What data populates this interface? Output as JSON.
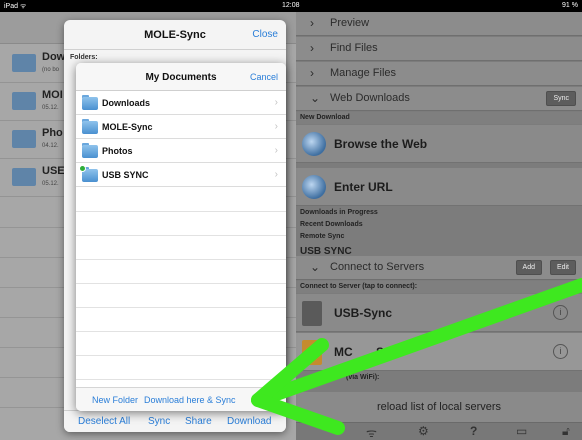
{
  "status_bar": {
    "device": "iPad ᯤ",
    "time": "12:08",
    "battery": "91 %"
  },
  "left_list": {
    "items": [
      {
        "title": "Dow",
        "subtitle": "(no bo"
      },
      {
        "title": "MOI",
        "subtitle": "05.12."
      },
      {
        "title": "Pho",
        "subtitle": "04.12."
      },
      {
        "title": "USE",
        "subtitle": "05.12."
      }
    ]
  },
  "outer_popover": {
    "title": "MOLE-Sync",
    "close_label": "Close",
    "folders_label": "Folders:",
    "toolbar": {
      "deselect_all": "Deselect All",
      "sync": "Sync",
      "share": "Share",
      "download": "Download"
    }
  },
  "inner_popover": {
    "title": "My Documents",
    "cancel_label": "Cancel",
    "folders": [
      {
        "label": "Downloads",
        "chevron": "›"
      },
      {
        "label": "MOLE-Sync",
        "chevron": "›"
      },
      {
        "label": "Photos",
        "chevron": "›"
      },
      {
        "label": "USB SYNC",
        "chevron": "›"
      }
    ],
    "footer": {
      "new_folder": "New Folder",
      "download_here": "Download here & Sync"
    }
  },
  "right_pane": {
    "menu": [
      {
        "chevron": "›",
        "label": "Preview"
      },
      {
        "chevron": "›",
        "label": "Find Files"
      },
      {
        "chevron": "›",
        "label": "Manage Files"
      }
    ],
    "web_downloads": {
      "chevron": "⌄",
      "label": "Web Downloads",
      "sync_button": "Sync",
      "new_download_header": "New Download",
      "browse": "Browse the Web",
      "enter_url": "Enter URL",
      "in_progress": "Downloads in Progress",
      "recent": "Recent Downloads",
      "remote_sync": "Remote Sync",
      "usb_sync_partial": "USB SYNC"
    },
    "servers": {
      "chevron": "⌄",
      "label": "Connect to Servers",
      "add_button": "Add",
      "edit_button": "Edit",
      "connect_header": "Connect to Server (tap to connect):",
      "usb_sync": "USB-Sync",
      "mole_sync_partial": "MC",
      "mole_sync_partial_2": "Sync",
      "wifi_header_partial": "(via WiFi):",
      "reload": "reload list of local servers",
      "info_glyph": "i"
    },
    "toolbar_icons": {
      "wifi": "wifi-icon",
      "gear": "gear-icon",
      "help": "?",
      "screen": "screen-icon",
      "lock": "lock-icon"
    }
  },
  "colors": {
    "accent": "#2a7ed8",
    "arrow": "#3ee81f"
  }
}
